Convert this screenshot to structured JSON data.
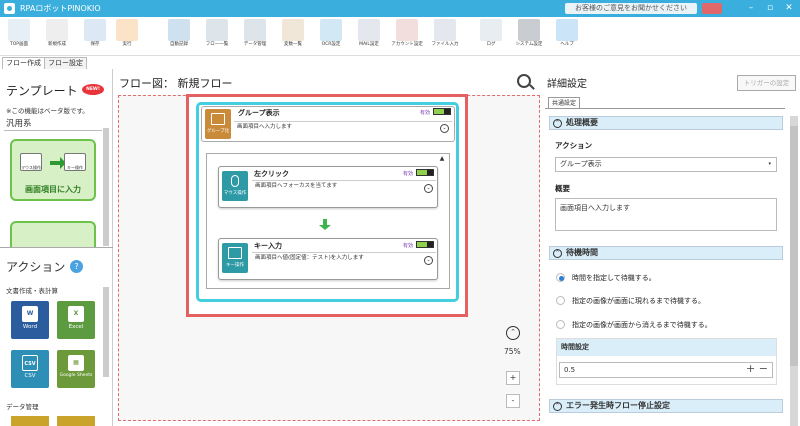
{
  "window": {
    "title": "RPAロボットPINOKIO",
    "feedback": "お客様のご意見をお聞かせください",
    "minimize": "–",
    "maximize": "▫",
    "close": "✕"
  },
  "toolbar": [
    {
      "id": "top",
      "label": "TOP画面",
      "color": "#e6eef6"
    },
    {
      "id": "new",
      "label": "新規作成",
      "color": "#eeeeee"
    },
    {
      "id": "save",
      "label": "保存",
      "color": "#dce8f3"
    },
    {
      "id": "run",
      "label": "実行",
      "color": "#fbe3c7"
    },
    {
      "id": "autorec",
      "label": "自動記録",
      "color": "#cfe0ef"
    },
    {
      "id": "flowlist",
      "label": "フロー一覧",
      "color": "#dde4ea"
    },
    {
      "id": "datamgmt",
      "label": "データ管理",
      "color": "#dde4ea"
    },
    {
      "id": "vars",
      "label": "変数一覧",
      "color": "#f1e7d8"
    },
    {
      "id": "ocr",
      "label": "OCR設定",
      "color": "#d3e8f5"
    },
    {
      "id": "mail",
      "label": "MAIL設定",
      "color": "#e4e7ee"
    },
    {
      "id": "account",
      "label": "アカウント設定",
      "color": "#f3dede"
    },
    {
      "id": "fileinput",
      "label": "ファイル入力",
      "color": "#e4e7ee"
    },
    {
      "id": "log",
      "label": "ログ",
      "color": "#e8edf2"
    },
    {
      "id": "sysconf",
      "label": "システム設定",
      "color": "#c9cdd2"
    },
    {
      "id": "help",
      "label": "ヘルプ",
      "color": "#cbe4f7"
    }
  ],
  "tabs": {
    "flow_create": "フロー作成",
    "flow_settings": "フロー設定"
  },
  "template": {
    "title": "テンプレート",
    "new_badge": "NEW!",
    "beta_note": "※この機能はベータ版です。",
    "group": "汎用系",
    "card1": {
      "left": "マウス操作",
      "right": "キー操作",
      "caption": "画面項目に入力"
    }
  },
  "action": {
    "title": "アクション",
    "help": "?",
    "category1": "文書作成・表計算",
    "category2": "データ管理",
    "tiles": [
      {
        "name": "Word",
        "glyph": "W",
        "bg": "#2b5d9e"
      },
      {
        "name": "Excel",
        "glyph": "X",
        "bg": "#5c9b3f"
      },
      {
        "name": "CSV",
        "glyph": "CSV",
        "bg": "#2d8fb5"
      },
      {
        "name": "Google Sheets",
        "glyph": "▦",
        "bg": "#6c9a3a"
      }
    ]
  },
  "canvas": {
    "label": "フロー図：",
    "name": "新規フロー",
    "zoom": "75%",
    "zoom_up": "⌃",
    "zoom_in": "+",
    "zoom_out": "-",
    "group": {
      "badge": "グループ化",
      "title": "グループ表示",
      "status": "有効",
      "desc": "画面項目へ入力します",
      "chev": "⌄",
      "scroll_up": "▲"
    },
    "nodes": [
      {
        "badge": "マウス操作",
        "title": "左クリック",
        "status": "有効",
        "desc": "画面項目へフォーカスを当てます",
        "chev": "⌄"
      },
      {
        "badge": "キー操作",
        "title": "キー入力",
        "status": "有効",
        "desc": "画面項目へ値(固定値：テスト)を入力します",
        "chev": "⌄"
      }
    ]
  },
  "details": {
    "title": "詳細設定",
    "trigger_btn": "トリガーの設定",
    "tab": "共通設定",
    "sections": {
      "overview": "処理概要",
      "wait": "待機時間",
      "error": "エラー発生時フロー停止設定"
    },
    "action_label": "アクション",
    "action_value": "グループ表示",
    "select_arrow": "▾",
    "summary_label": "概要",
    "summary_value": "画面項目へ入力します",
    "wait_options": [
      "時間を指定して待機する。",
      "指定の画像が画面に現れるまで待機する。",
      "指定の画像が画面から消えるまで待機する。"
    ],
    "wait_selected": 0,
    "time_label": "時間設定",
    "time_value": "0.5",
    "stepper": "+ −",
    "collapse": "^"
  }
}
